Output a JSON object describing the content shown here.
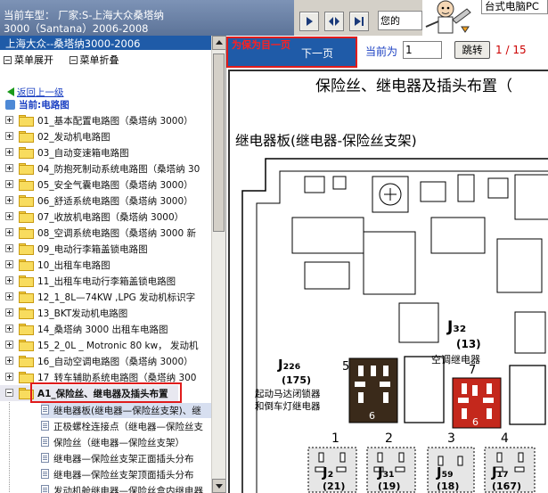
{
  "header": {
    "vehicle_line1": "当前车型： 厂家:S-上海大众桑塔纳",
    "vehicle_line2": "3000（Santana）2006-2008",
    "message_text": "您的",
    "ad_text": "台式电脑PC"
  },
  "sidebar": {
    "title": "上海大众--桑塔纳3000-2006",
    "expand_label": "菜单展开",
    "collapse_label": "菜单折叠",
    "back_label": "返回上一级",
    "current_label": "当前:电路图",
    "items": [
      {
        "label": "01_基本配置电路图（桑塔纳 3000）"
      },
      {
        "label": "02_发动机电路图"
      },
      {
        "label": "03_自动变速箱电路图"
      },
      {
        "label": "04_防抱死制动系统电路图（桑塔纳 30"
      },
      {
        "label": "05_安全气囊电路图（桑塔纳 3000）"
      },
      {
        "label": "06_舒适系统电路图（桑塔纳 3000）"
      },
      {
        "label": "07_收放机电路图（桑塔纳 3000）"
      },
      {
        "label": "08_空调系统电路图（桑塔纳 3000 新"
      },
      {
        "label": "09_电动行李箱盖锁电路图"
      },
      {
        "label": "10_出租车电路图"
      },
      {
        "label": "11_出租车电动行李箱盖锁电路图"
      },
      {
        "label": "12_1_8L—74KW ,LPG 发动机标识字"
      },
      {
        "label": "13_BKT发动机电路图"
      },
      {
        "label": "14_桑塔纳 3000 出租车电路图"
      },
      {
        "label": "15_2_0L _ Motronic 80 kw， 发动机"
      },
      {
        "label": "16_自动空调电路图（桑塔纳 3000）"
      },
      {
        "label": "17_转车辅助系统电路图（桑塔纳 300"
      },
      {
        "label": "A1_保险丝、继电器及插头布置"
      }
    ],
    "subitems": [
      {
        "label": "继电器板(继电器—保险丝支架)、继"
      },
      {
        "label": "正极螺栓连接点（继电器—保险丝支"
      },
      {
        "label": "保险丝（继电器—保险丝支架）"
      },
      {
        "label": "继电器—保险丝支架正面插头分布"
      },
      {
        "label": "继电器—保险丝支架顶面插头分布"
      },
      {
        "label": "发动机舱继电器—保险丝盒内继电器"
      }
    ]
  },
  "toolbar": {
    "toc_label": "为保为目一页",
    "next_label": "下一页",
    "current_page_label": "当前为",
    "page_value": "1",
    "jump_label": "跳转",
    "page_current": "1",
    "page_sep": "/",
    "page_total": "15"
  },
  "document": {
    "title": "保险丝、继电器及插头布置（",
    "subtitle": "继电器板(继电器-保险丝支架)",
    "labels": {
      "j32": "J₃₂",
      "j32_num": "(13)",
      "ac_relay": "空调继电器",
      "j226": "J₂₂₆",
      "j226_num": "(175)",
      "j226_desc1": "起动马达闭锁器",
      "j226_desc2": "和倒车灯继电器",
      "n1": "1",
      "n2": "2",
      "n3": "3",
      "n4": "4",
      "n5": "5",
      "n6": "6",
      "n7": "7",
      "j2": "J₂",
      "j2_num": "(21)",
      "j31": "J₃₁",
      "j31_num": "(19)",
      "j59": "J₅₉",
      "j59_num": "(18)",
      "j17": "J₁₇",
      "j17_num": "(167)"
    }
  }
}
